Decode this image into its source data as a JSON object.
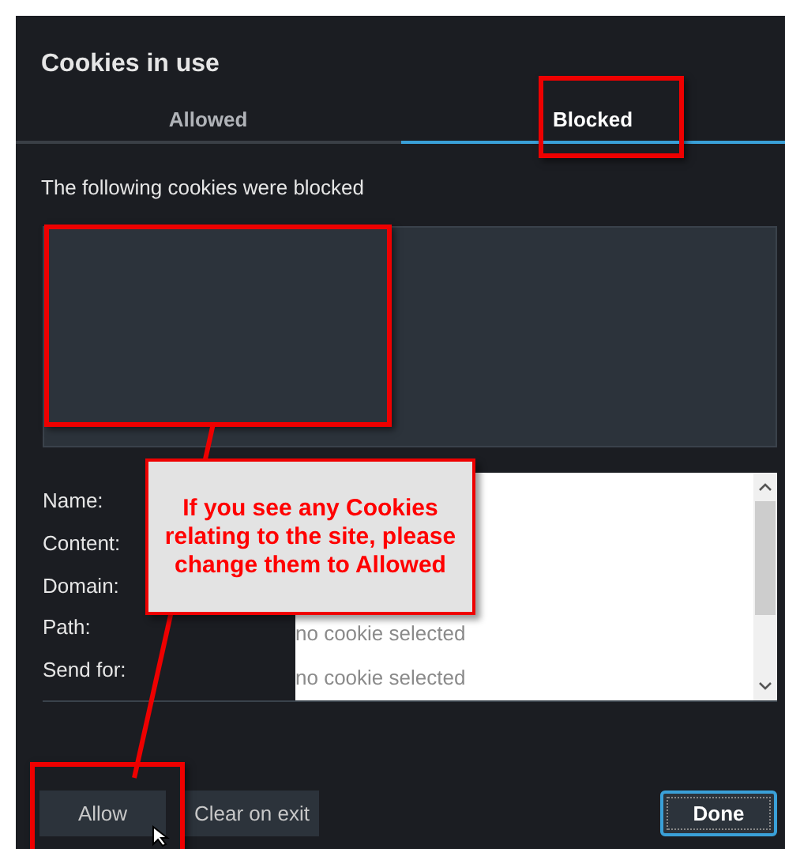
{
  "dialog": {
    "title": "Cookies in use"
  },
  "tabs": [
    {
      "label": "Allowed",
      "selected": false
    },
    {
      "label": "Blocked",
      "selected": true
    }
  ],
  "message": "The following cookies were blocked",
  "details": [
    {
      "label": "Name:"
    },
    {
      "label": "Content:"
    },
    {
      "label": "Domain:"
    },
    {
      "label": "Path:",
      "value": "no cookie selected"
    },
    {
      "label": "Send for:",
      "value": "no cookie selected"
    }
  ],
  "buttons": [
    {
      "label": "Allow",
      "default": false
    },
    {
      "label": "Clear on exit",
      "default": false
    },
    {
      "label": "Done",
      "default": true
    }
  ],
  "annotation": {
    "text": "If you see any Cookies relating to the site, please change them to Allowed"
  }
}
